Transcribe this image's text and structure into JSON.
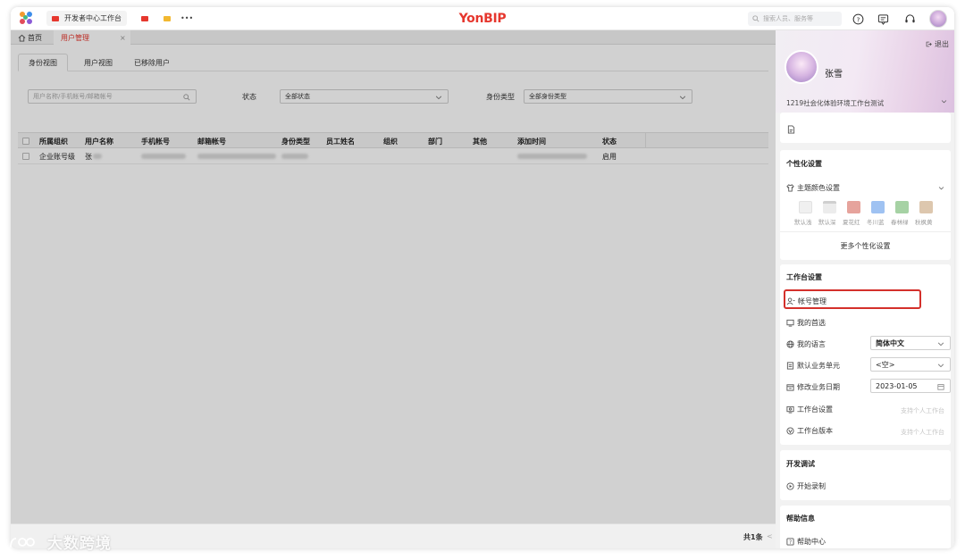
{
  "topbar": {
    "tabs": [
      {
        "label": "开发者中心工作台"
      },
      {
        "label": ""
      },
      {
        "label": ""
      }
    ],
    "more": "•••",
    "brand": "YonBIP",
    "search_placeholder": "搜索人员、服务等",
    "colors": {
      "brand": "#e6372e"
    }
  },
  "page_tabs": {
    "home": "首页",
    "active": "用户管理",
    "close": "×"
  },
  "sub_tabs": [
    "身份视图",
    "用户视图",
    "已移除用户"
  ],
  "filters": {
    "search_placeholder": "用户名称/手机帐号/邮箱帐号",
    "status_label": "状态",
    "status_value": "全部状态",
    "type_label": "身份类型",
    "type_value": "全部身份类型"
  },
  "table": {
    "columns": [
      "所属组织",
      "用户名称",
      "手机帐号",
      "邮箱帐号",
      "身份类型",
      "员工姓名",
      "组织",
      "部门",
      "其他",
      "添加时间",
      "状态"
    ],
    "rows": [
      {
        "org": "企业账号级",
        "name": "张",
        "status": "启用"
      }
    ]
  },
  "footer": {
    "total": "共1条",
    "prev": "<"
  },
  "drawer": {
    "logout": "退出",
    "user_name": "张雪",
    "org_name": "1219社会化体验环境工作台测试",
    "personalization": {
      "title": "个性化设置",
      "theme_label": "主题颜色设置",
      "swatches": [
        {
          "label": "默认浅",
          "color": "#f0f0f0"
        },
        {
          "label": "默认深",
          "color": "#e4e4e4"
        },
        {
          "label": "夏花红",
          "color": "#e6a39c"
        },
        {
          "label": "冬川蓝",
          "color": "#9fc2f2"
        },
        {
          "label": "春林绿",
          "color": "#a6d2a4"
        },
        {
          "label": "秋枫黄",
          "color": "#ddc7ae"
        }
      ],
      "more": "更多个性化设置"
    },
    "workbench": {
      "title": "工作台设置",
      "account": "帐号管理",
      "preference": "我的首选",
      "language_label": "我的语言",
      "language_value": "简体中文",
      "unit_label": "默认业务单元",
      "unit_value": "<空>",
      "date_label": "修改业务日期",
      "date_value": "2023-01-05",
      "settings_label": "工作台设置",
      "settings_note": "支持个人工作台",
      "version_label": "工作台版本",
      "version_note": "支持个人工作台"
    },
    "dev": {
      "title": "开发调试",
      "record": "开始录制"
    },
    "help": {
      "title": "帮助信息",
      "center": "帮助中心"
    }
  },
  "watermark": "大数跨境"
}
